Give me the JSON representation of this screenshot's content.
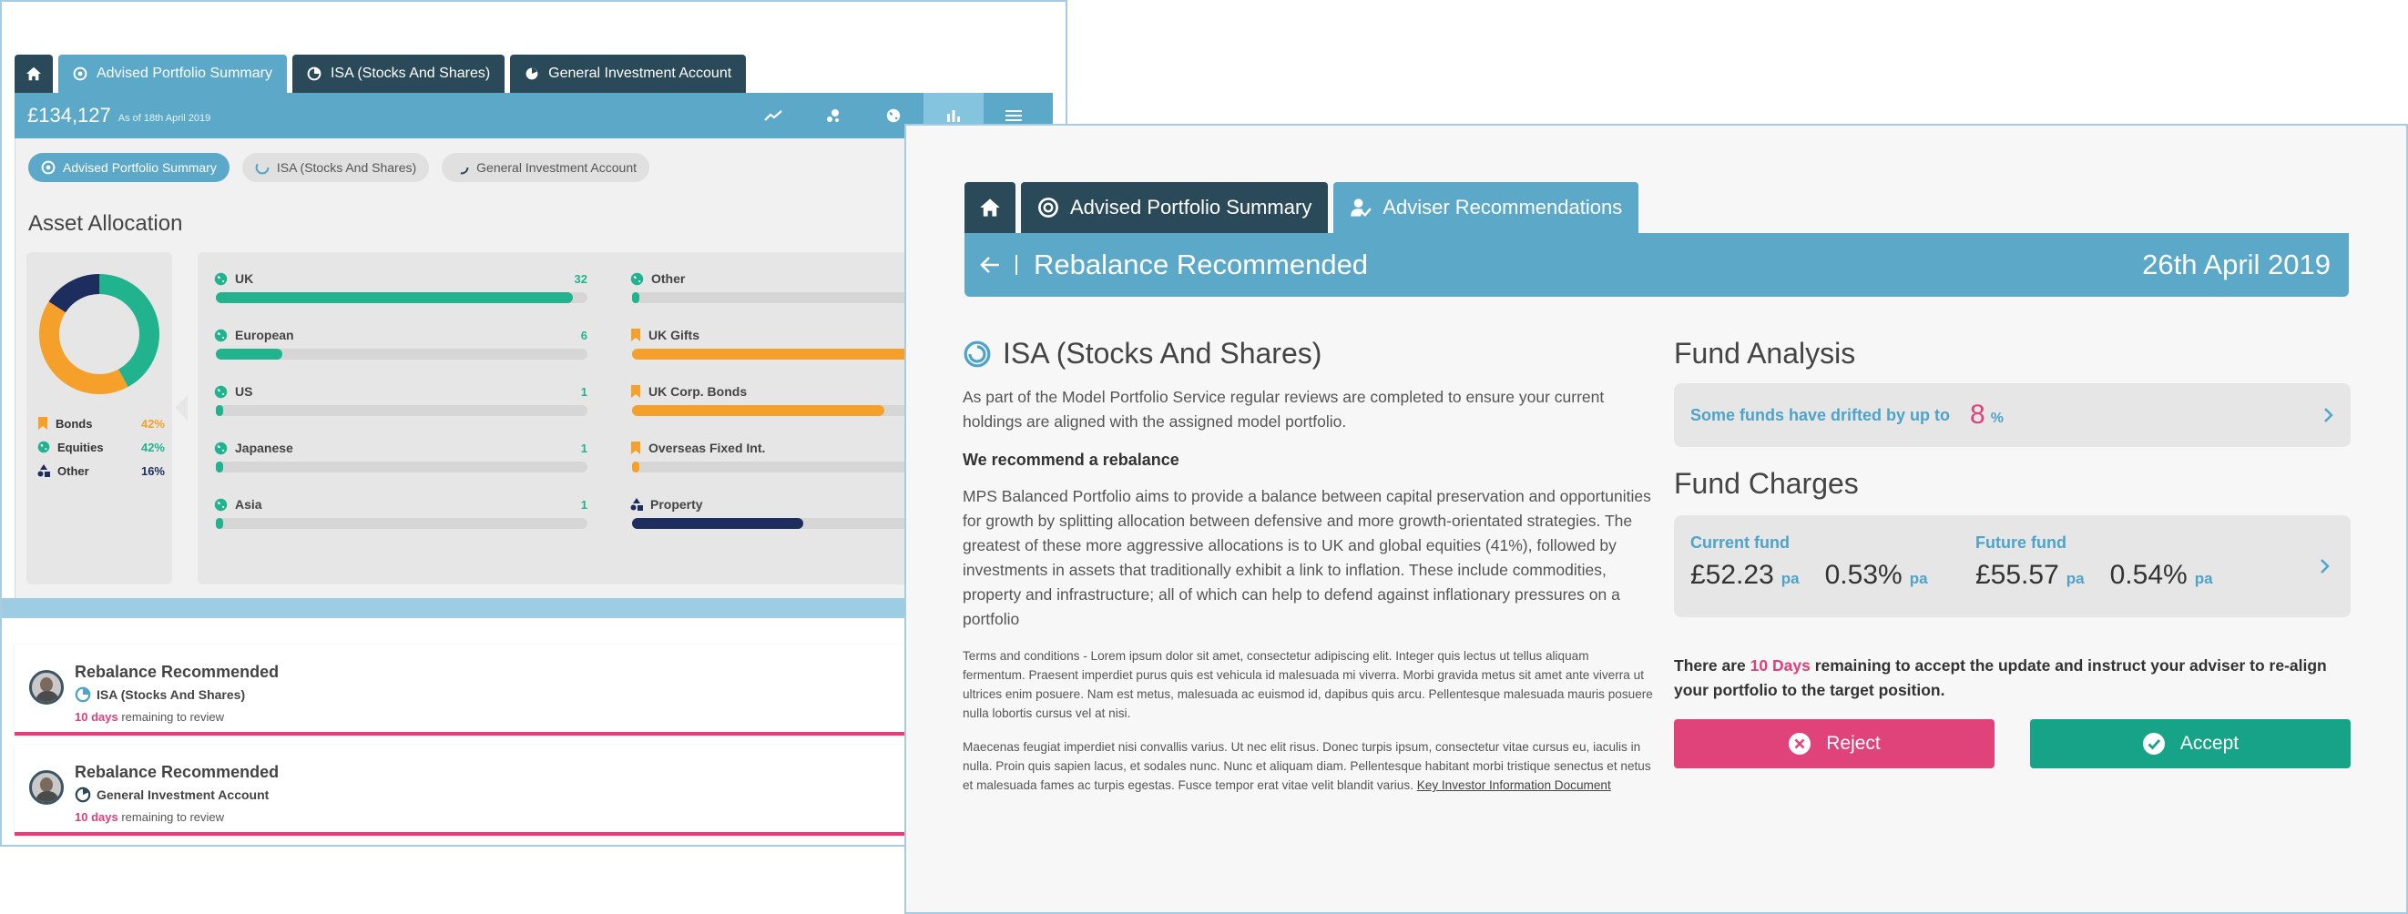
{
  "colors": {
    "accent_blue": "#5ba8c9",
    "dark_tab": "#2a4a5a",
    "teal": "#20b38e",
    "orange": "#f5a02a",
    "navy": "#1d2d5e",
    "pink": "#e0407a",
    "accept_green": "#16a388"
  },
  "back_window": {
    "tabs": [
      {
        "label": "",
        "icon": "home-icon"
      },
      {
        "label": "Advised Portfolio Summary",
        "icon": "portfolio-icon"
      },
      {
        "label": "ISA (Stocks And Shares)",
        "icon": "isa-icon"
      },
      {
        "label": "General Investment Account",
        "icon": "gia-icon"
      }
    ],
    "header": {
      "amount": "£134,127",
      "as_of": "As of 18th April 2019"
    },
    "chips": [
      {
        "label": "Advised Portfolio Summary"
      },
      {
        "label": "ISA (Stocks And Shares)"
      },
      {
        "label": "General Investment Account"
      }
    ],
    "asset_allocation": {
      "title": "Asset Allocation",
      "legend": [
        {
          "label": "Bonds",
          "value": "42%",
          "color": "#f5a02a",
          "icon": "bookmark-icon"
        },
        {
          "label": "Equities",
          "value": "42%",
          "color": "#20b38e",
          "icon": "globe-icon"
        },
        {
          "label": "Other",
          "value": "16%",
          "color": "#1d2d5e",
          "icon": "shapes-icon"
        }
      ],
      "bars_left": [
        {
          "name": "UK",
          "value": "32",
          "fill": 0.96
        },
        {
          "name": "European",
          "value": "6",
          "fill": 0.18
        },
        {
          "name": "US",
          "value": "1",
          "fill": 0.02
        },
        {
          "name": "Japanese",
          "value": "1",
          "fill": 0.02
        },
        {
          "name": "Asia",
          "value": "1",
          "fill": 0.02
        }
      ],
      "bars_right": [
        {
          "name": "Other",
          "value": "",
          "fill": 0.02,
          "color": "#20b38e",
          "icon": "globe-icon"
        },
        {
          "name": "UK Gifts",
          "value": "",
          "fill": 0.86,
          "color": "#f5a02a",
          "icon": "bookmark-icon"
        },
        {
          "name": "UK Corp. Bonds",
          "value": "",
          "fill": 0.68,
          "color": "#f5a02a",
          "icon": "bookmark-icon"
        },
        {
          "name": "Overseas Fixed Int.",
          "value": "",
          "fill": 0.02,
          "color": "#f5a02a",
          "icon": "bookmark-icon"
        },
        {
          "name": "Property",
          "value": "",
          "fill": 0.46,
          "color": "#1d2d5e",
          "icon": "shapes-icon"
        }
      ]
    },
    "cards": [
      {
        "title": "Rebalance Recommended",
        "account": "ISA (Stocks And Shares)",
        "days": "10 days",
        "rem": "remaining to review"
      },
      {
        "title": "Rebalance Recommended",
        "account": "General Investment Account",
        "days": "10 days",
        "rem": "remaining to review"
      }
    ]
  },
  "front_window": {
    "tabs": [
      {
        "label": "",
        "icon": "home-icon"
      },
      {
        "label": "Advised Portfolio Summary",
        "icon": "portfolio-icon"
      },
      {
        "label": "Adviser Recommendations",
        "icon": "adviser-icon"
      }
    ],
    "header": {
      "title": "Rebalance Recommended",
      "date": "26th April 2019"
    },
    "account_title": "ISA (Stocks And Shares)",
    "intro": "As part of the Model Portfolio Service regular reviews are completed to ensure your current holdings are aligned with the assigned model portfolio.",
    "recommend": "We recommend a rebalance",
    "description": "MPS Balanced Portfolio aims to provide a balance between capital preservation and opportunities for growth by splitting allocation between defensive and more growth-orientated strategies. The greatest of these more aggressive allocations is to UK and global equities (41%), followed by investments in assets that traditionally exhibit a link to inflation. These include commodities, property and infrastructure; all of which can help to defend against inflationary pressures on a portfolio",
    "terms1": "Terms and conditions - Lorem ipsum dolor sit amet, consectetur adipiscing elit. Integer quis lectus ut tellus aliquam fermentum. Praesent imperdiet purus quis est vehicula id malesuada mi viverra. Morbi gravida metus sit amet ante viverra ut ultrices enim posuere. Nam est metus, malesuada ac euismod id, dapibus quis arcu. Pellentesque malesuada mauris posuere nulla lobortis cursus vel at nisi.",
    "terms2": "Maecenas feugiat imperdiet nisi convallis varius. Ut nec elit risus. Donec turpis ipsum, consectetur vitae cursus eu, iaculis in nulla. Proin quis sapien lacus, et sodales nunc. Nunc et aliquam diam. Pellentesque habitant morbi tristique senectus et netus et malesuada fames ac turpis egestas. Fusce tempor erat vitae velit blandit varius.",
    "kiid_link": "Key Investor Information Document",
    "fund_analysis": {
      "title": "Fund Analysis",
      "text": "Some funds have drifted by up to",
      "value": "8",
      "unit": "%"
    },
    "fund_charges": {
      "title": "Fund Charges",
      "current": {
        "label": "Current fund",
        "amount": "£52.23",
        "amount_unit": "pa",
        "pct": "0.53%",
        "pct_unit": "pa"
      },
      "future": {
        "label": "Future fund",
        "amount": "£55.57",
        "amount_unit": "pa",
        "pct": "0.54%",
        "pct_unit": "pa"
      }
    },
    "notice": {
      "before": "There are ",
      "days": "10 Days",
      "after": " remaining to accept the update and instruct your adviser to re-align your portfolio to the target position."
    },
    "buttons": {
      "reject": "Reject",
      "accept": "Accept"
    }
  }
}
